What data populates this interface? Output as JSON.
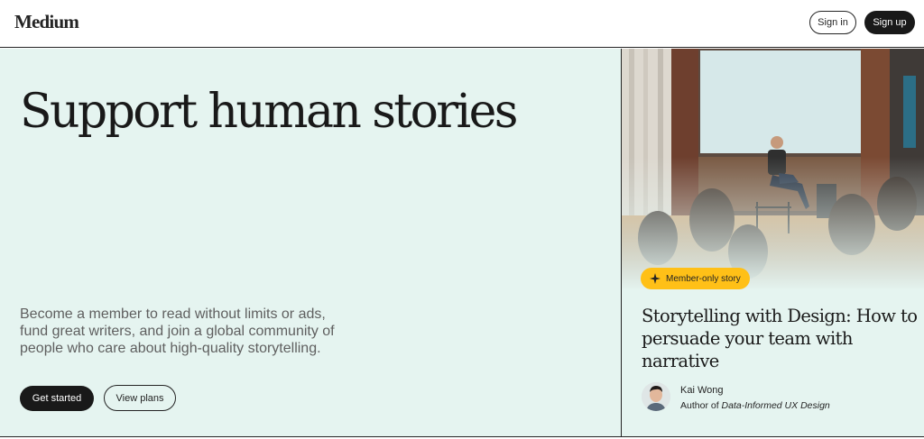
{
  "header": {
    "logo": "Medium",
    "sign_in": "Sign in",
    "sign_up": "Sign up"
  },
  "hero": {
    "headline": "Support human stories",
    "description": "Become a member to read without limits or ads, fund great writers, and join a global community of people who care about high-quality storytelling.",
    "get_started": "Get started",
    "view_plans": "View plans"
  },
  "story_card": {
    "badge": "Member-only story",
    "title": "Storytelling with Design: How to persuade your team with narrative",
    "author_name": "Kai Wong",
    "author_role_prefix": "Author of ",
    "author_role_book": "Data-Informed UX Design"
  },
  "colors": {
    "hero_bg": "#e5f4f0",
    "primary_button": "#191919",
    "badge": "#ffc017"
  }
}
